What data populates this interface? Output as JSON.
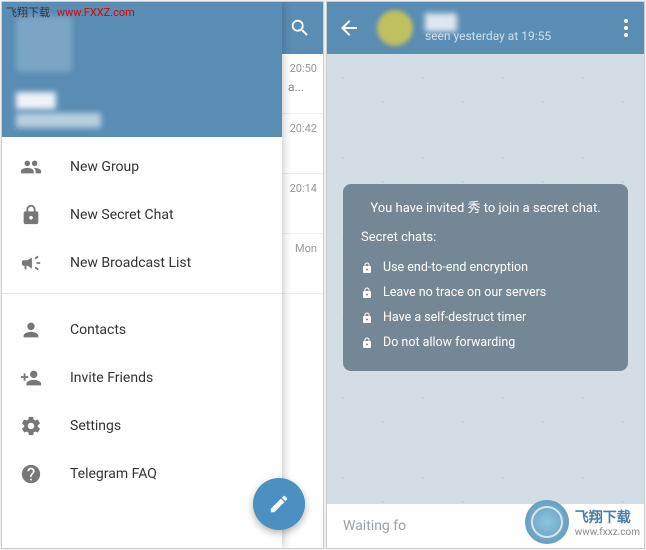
{
  "watermark": {
    "top_label": "飞翔下载",
    "top_url": "www.FXXZ.com",
    "bottom_label": "飞翔下载",
    "bottom_url": "www.fxxz.com"
  },
  "drawer": {
    "menu": [
      {
        "id": "new-group",
        "label": "New Group",
        "icon": "group"
      },
      {
        "id": "new-secret-chat",
        "label": "New Secret Chat",
        "icon": "lock"
      },
      {
        "id": "new-broadcast",
        "label": "New Broadcast List",
        "icon": "broadcast"
      }
    ],
    "menu2": [
      {
        "id": "contacts",
        "label": "Contacts",
        "icon": "person"
      },
      {
        "id": "invite",
        "label": "Invite Friends",
        "icon": "invite"
      },
      {
        "id": "settings",
        "label": "Settings",
        "icon": "gear"
      },
      {
        "id": "faq",
        "label": "Telegram FAQ",
        "icon": "help"
      }
    ]
  },
  "chat_list": {
    "rows": [
      {
        "time": "20:50",
        "preview": "a..."
      },
      {
        "time": "20:42",
        "preview": ""
      },
      {
        "time": "20:14",
        "preview": ""
      },
      {
        "time": "Mon",
        "preview": ""
      }
    ]
  },
  "secret_chat": {
    "status": "seen yesterday at 19:55",
    "invite_line": "You have invited 秀 to join a secret chat.",
    "heading": "Secret chats:",
    "points": [
      "Use end-to-end encryption",
      "Leave no trace on our servers",
      "Have a self-destruct timer",
      "Do not allow forwarding"
    ],
    "input_placeholder": "Waiting fo"
  }
}
